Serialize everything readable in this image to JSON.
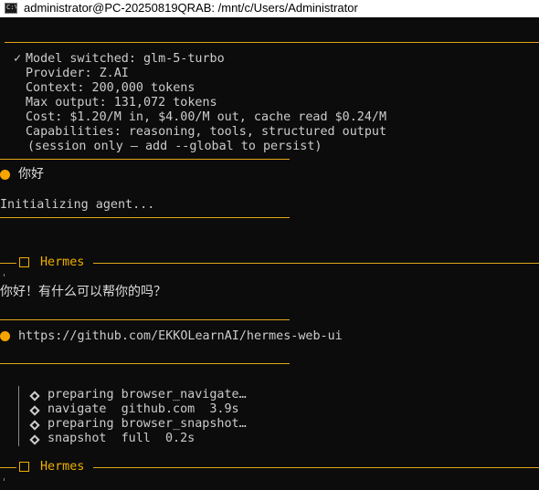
{
  "window": {
    "title": "administrator@PC-20250819QRAB: /mnt/c/Users/Administrator",
    "icon": "console-icon",
    "icon_text": "C:\\"
  },
  "colors": {
    "accent": "#f0b000",
    "text": "#cccccc",
    "background": "#0c0c0c"
  },
  "status_block": {
    "check": "✓",
    "model_line": "Model switched: glm-5-turbo",
    "provider_line": "Provider: Z.AI",
    "context_line": "Context: 200,000 tokens",
    "max_output_line": "Max output: 131,072 tokens",
    "cost_line": "Cost: $1.20/M in, $4.00/M out, cache read $0.24/M",
    "capabilities_line": "Capabilities: reasoning, tools, structured output",
    "session_line": "(session only — add --global to persist)"
  },
  "user_message_1": "你好",
  "init_line": "Initializing agent...",
  "hermes_header_1": "Hermes",
  "assistant_reply_1": "你好！有什么可以帮你的吗？",
  "user_message_2": "https://github.com/EKKOLearnAI/hermes-web-ui",
  "tool_calls": [
    {
      "icon": "tool-icon",
      "text": "preparing browser_navigate…"
    },
    {
      "icon": "tool-icon",
      "text": "navigate  github.com  3.9s"
    },
    {
      "icon": "tool-icon",
      "text": "preparing browser_snapshot…"
    },
    {
      "icon": "tool-icon",
      "text": "snapshot  full  0.2s"
    }
  ],
  "hermes_header_2": "Hermes"
}
